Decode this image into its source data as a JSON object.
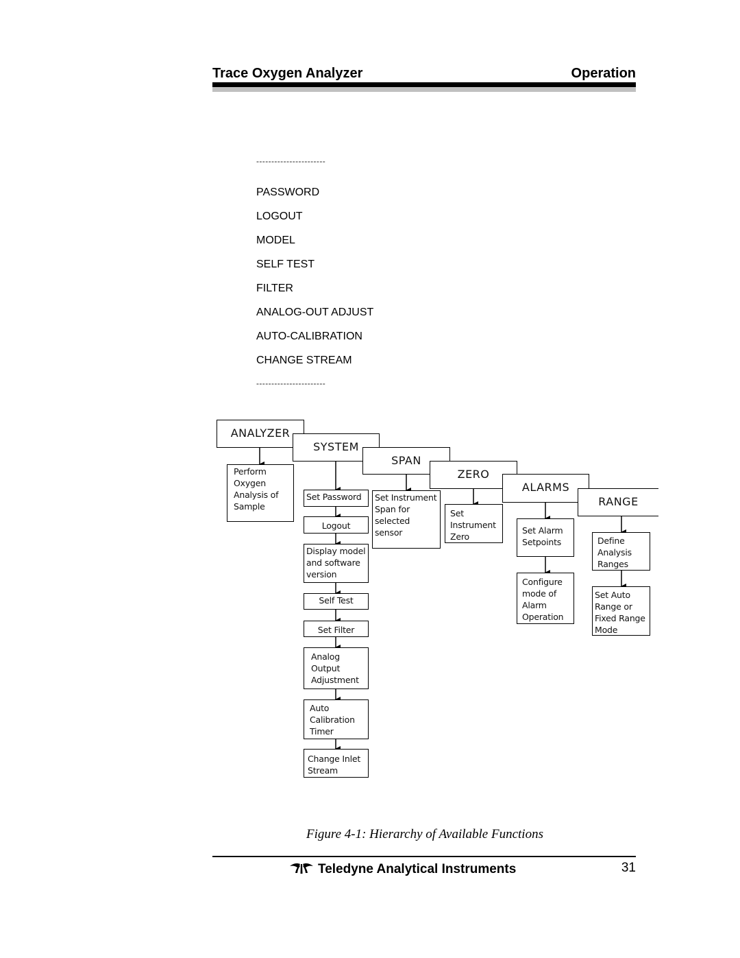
{
  "header": {
    "title": "Trace Oxygen Analyzer",
    "section": "Operation"
  },
  "menu": {
    "separator": "-----------------------",
    "items": [
      "PASSWORD",
      "LOGOUT",
      "MODEL",
      "SELF TEST",
      "FILTER",
      "ANALOG-OUT ADJUST",
      "AUTO-CALIBRATION",
      "CHANGE STREAM"
    ]
  },
  "diagram": {
    "analyzer": {
      "label": "ANALYZER",
      "children": [
        "Perform Oxygen Analysis of Sample"
      ]
    },
    "system": {
      "label": "SYSTEM",
      "children": [
        "Set Password",
        "Logout",
        "Display model and software version",
        "Self Test",
        "Set Filter",
        "Analog Output Adjustment",
        "Auto Calibration Timer",
        "Change Inlet Stream"
      ]
    },
    "span": {
      "label": "SPAN",
      "children": [
        "Set Instrument Span for selected sensor"
      ]
    },
    "zero": {
      "label": "ZERO",
      "children": [
        "Set Instrument Zero"
      ]
    },
    "alarms": {
      "label": "ALARMS",
      "children": [
        "Set Alarm Setpoints",
        "Configure mode of Alarm Operation"
      ]
    },
    "range": {
      "label": "RANGE",
      "children": [
        "Define Analysis Ranges",
        "Set Auto Range or Fixed Range Mode"
      ]
    }
  },
  "caption": "Figure 4-1: Hierarchy of Available Functions",
  "footer": {
    "brand": "Teledyne Analytical Instruments",
    "page_number": "31"
  }
}
